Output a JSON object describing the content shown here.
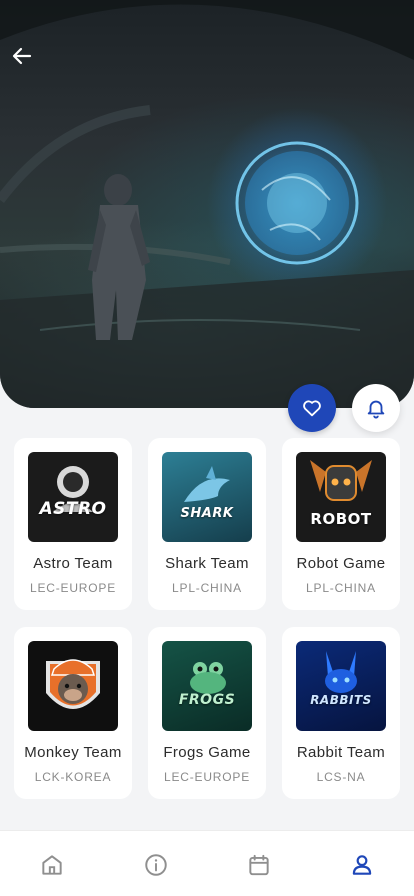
{
  "header": {
    "back_icon": "arrow-left-icon",
    "hero_image": "dark sci-fi tunnel with a figure facing a glowing blue portal"
  },
  "actions": {
    "favorite_icon": "heart-icon",
    "favorite_color": "#1f47b8",
    "notify_icon": "bell-icon",
    "notify_color": "#1f47b8"
  },
  "teams": [
    {
      "name": "Astro Team",
      "league": "LEC-EUROPE",
      "logo_text": "ASTRO",
      "logo_bg": "#1b1b1b"
    },
    {
      "name": "Shark Team",
      "league": "LPL-CHINA",
      "logo_text": "SHARK",
      "logo_bg": "#1f5f73"
    },
    {
      "name": "Robot Game",
      "league": "LPL-CHINA",
      "logo_text": "ROBOT",
      "logo_bg": "#1a1a1a"
    },
    {
      "name": "Monkey Team",
      "league": "LCK-KOREA",
      "logo_text": "",
      "logo_bg": "#0f0f0f"
    },
    {
      "name": "Frogs Game",
      "league": "LEC-EUROPE",
      "logo_text": "FROGS",
      "logo_bg": "#0d3b33"
    },
    {
      "name": "Rabbit Team",
      "league": "LCS-NA",
      "logo_text": "RABBITS",
      "logo_bg": "#071a4d"
    }
  ],
  "nav": {
    "tabs": [
      {
        "icon": "home-icon",
        "active": false
      },
      {
        "icon": "info-icon",
        "active": false
      },
      {
        "icon": "calendar-icon",
        "active": false
      },
      {
        "icon": "user-icon",
        "active": true
      }
    ],
    "active_color": "#1f47b8",
    "inactive_color": "#8f8f8f"
  }
}
